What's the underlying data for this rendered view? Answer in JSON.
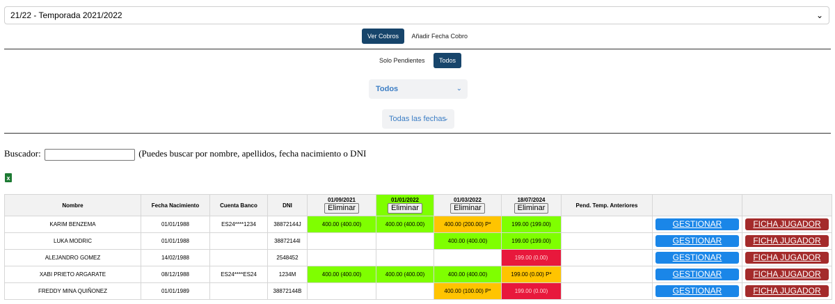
{
  "season": {
    "selected": "21/22 - Temporada 2021/2022"
  },
  "top_buttons": {
    "ver_cobros": "Ver Cobros",
    "anadir_fecha": "Añadir Fecha Cobro"
  },
  "filters": {
    "solo_pendientes": "Solo Pendientes",
    "todos": "Todos",
    "group_select": "Todos",
    "date_select": "Todas las fechas"
  },
  "search": {
    "label": "Buscador:",
    "hint": "(Puedes buscar por nombre, apellidos, fecha nacimiento o DNI",
    "value": ""
  },
  "excel_icon": "x",
  "table": {
    "headers": [
      "Nombre",
      "Fecha Nacimiento",
      "Cuenta Banco",
      "DNI"
    ],
    "date_columns": [
      "01/09/2021",
      "01/01/2022",
      "01/03/2022",
      "18/07/2024"
    ],
    "eliminar_label": "Eliminar",
    "pend_header": "Pend. Temp. Anteriores",
    "gestionar_label": "GESTIONAR",
    "ficha_label": "FICHA JUGADOR",
    "rows": [
      {
        "nombre": "KARIM BENZEMA",
        "fecha": "01/01/1988",
        "cuenta": "ES24****1234",
        "dni": "38872144J",
        "c1": "400.00 (400.00)",
        "c2": "400.00 (400.00)",
        "c3": "400.00 (200.00) P*",
        "c4": "199.00 (199.00)"
      },
      {
        "nombre": "LUKA MODRIC",
        "fecha": "01/01/1988",
        "cuenta": "",
        "dni": "38872144I",
        "c1": "",
        "c2": "",
        "c3": "400.00 (400.00)",
        "c4": "199.00 (199.00)"
      },
      {
        "nombre": "ALEJANDRO GOMEZ",
        "fecha": "14/02/1988",
        "cuenta": "",
        "dni": "2548452",
        "c1": "",
        "c2": "",
        "c3": "",
        "c4": "199.00 (0.00)"
      },
      {
        "nombre": "XABI PRIETO ARGARATE",
        "fecha": "08/12/1988",
        "cuenta": "ES24****ES24",
        "dni": "1234M",
        "c1": "400.00 (400.00)",
        "c2": "400.00 (400.00)",
        "c3": "400.00 (400.00)",
        "c4": "199.00 (0.00) P*"
      },
      {
        "nombre": "FREDDY MINA QUIÑONEZ",
        "fecha": "01/01/1989",
        "cuenta": "",
        "dni": "38872144B",
        "c1": "",
        "c2": "",
        "c3": "400.00 (100.00) P*",
        "c4": "199.00 (0.00)"
      }
    ]
  }
}
